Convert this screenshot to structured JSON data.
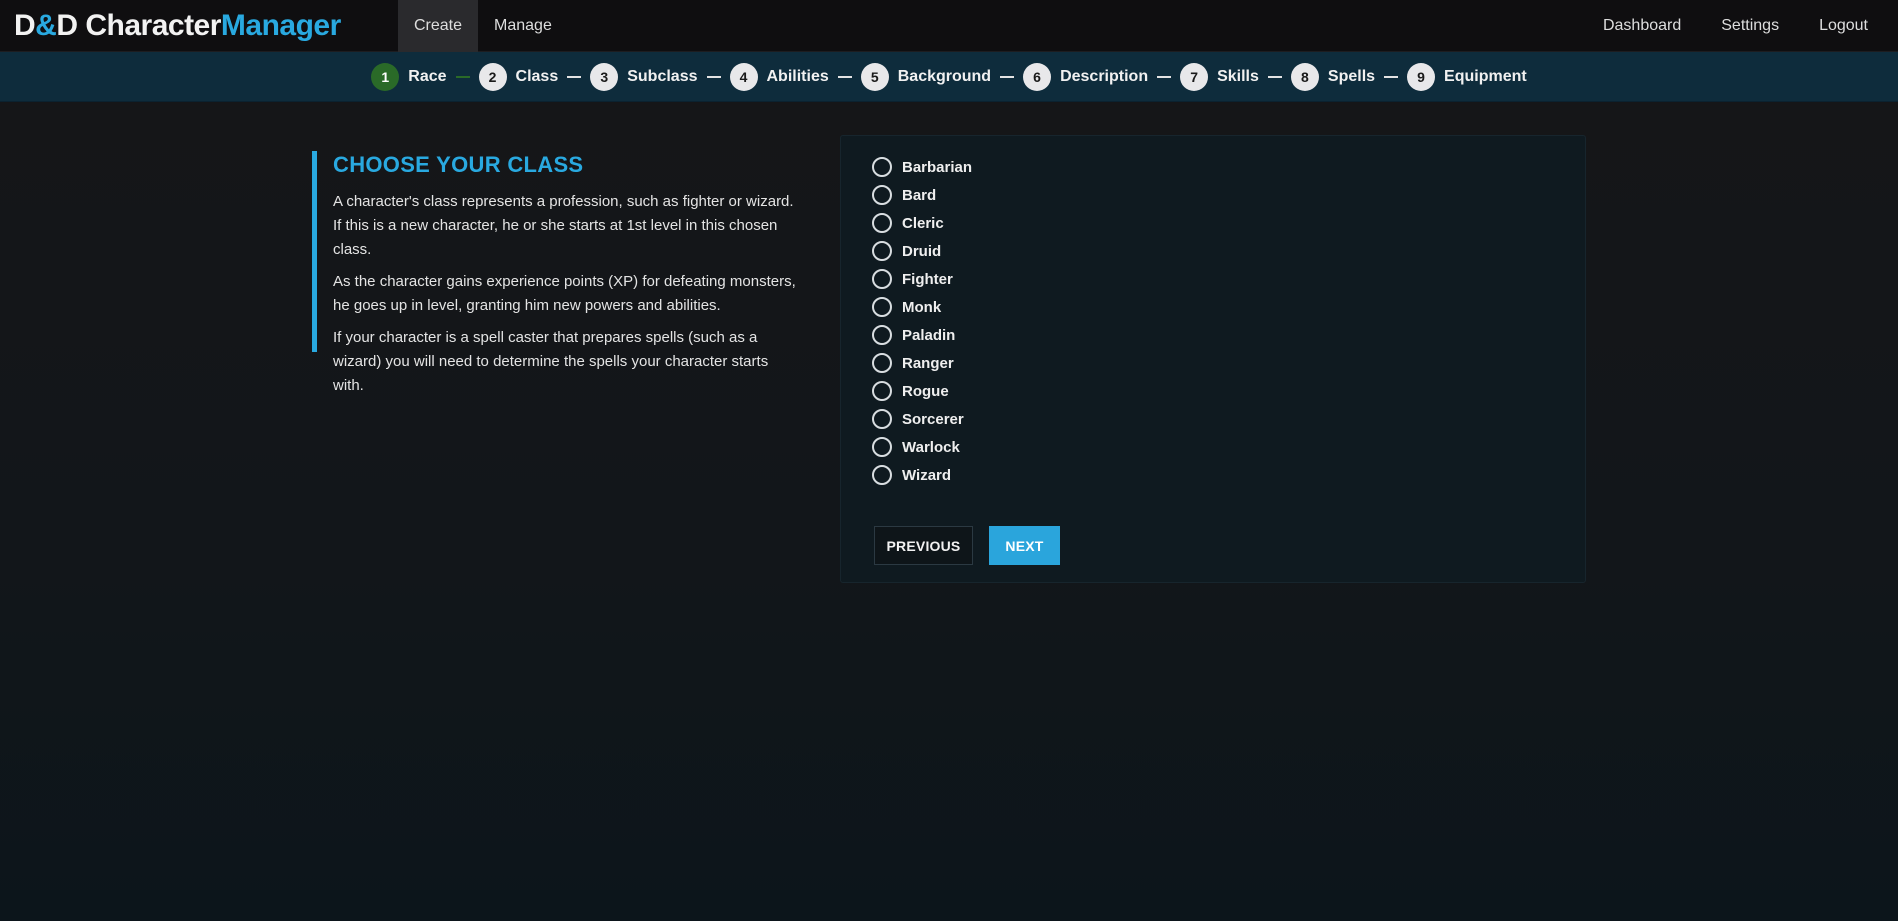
{
  "brand": {
    "part1": "D",
    "amp": "&",
    "part2": "D Character",
    "part3": "Manager"
  },
  "nav": {
    "left": [
      {
        "label": "Create",
        "active": true
      },
      {
        "label": "Manage",
        "active": false
      }
    ],
    "right": [
      {
        "label": "Dashboard"
      },
      {
        "label": "Settings"
      },
      {
        "label": "Logout"
      }
    ]
  },
  "steps": [
    {
      "num": "1",
      "label": "Race"
    },
    {
      "num": "2",
      "label": "Class"
    },
    {
      "num": "3",
      "label": "Subclass"
    },
    {
      "num": "4",
      "label": "Abilities"
    },
    {
      "num": "5",
      "label": "Background"
    },
    {
      "num": "6",
      "label": "Description"
    },
    {
      "num": "7",
      "label": "Skills"
    },
    {
      "num": "8",
      "label": "Spells"
    },
    {
      "num": "9",
      "label": "Equipment"
    }
  ],
  "info": {
    "title": "CHOOSE YOUR CLASS",
    "paragraphs": [
      "A character's class represents a profession, such as fighter or wizard. If this is a new character, he or she starts at 1st level in this chosen class.",
      "As the character gains experience points (XP) for defeating monsters, he goes up in level, granting him new powers and abilities.",
      "If your character is a spell caster that prepares spells (such as a wizard) you will need to determine the spells your character starts with."
    ]
  },
  "classes": [
    "Barbarian",
    "Bard",
    "Cleric",
    "Druid",
    "Fighter",
    "Monk",
    "Paladin",
    "Ranger",
    "Rogue",
    "Sorcerer",
    "Warlock",
    "Wizard"
  ],
  "buttons": {
    "previous": "PREVIOUS",
    "next": "NEXT"
  },
  "colors": {
    "accent": "#29a9e0",
    "current_step": "#2a6a28",
    "stepper_bg": "#0e2c3c"
  }
}
